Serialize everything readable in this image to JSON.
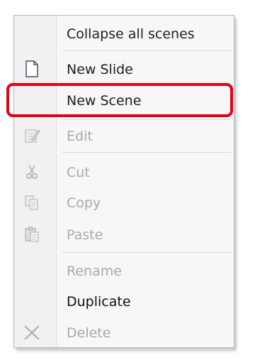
{
  "menu": {
    "items": [
      {
        "label": "Collapse all scenes",
        "state": "enabled"
      },
      {
        "label": "New Slide",
        "state": "enabled",
        "icon": "new-slide-icon"
      },
      {
        "label": "New Scene",
        "state": "enabled",
        "highlighted": true
      },
      {
        "label": "Edit",
        "state": "disabled",
        "icon": "edit-icon"
      },
      {
        "label": "Cut",
        "state": "disabled",
        "icon": "cut-icon"
      },
      {
        "label": "Copy",
        "state": "disabled",
        "icon": "copy-icon"
      },
      {
        "label": "Paste",
        "state": "disabled",
        "icon": "paste-icon"
      },
      {
        "label": "Rename",
        "state": "disabled"
      },
      {
        "label": "Duplicate",
        "state": "enabled"
      },
      {
        "label": "Delete",
        "state": "disabled",
        "icon": "delete-icon"
      }
    ]
  },
  "colors": {
    "highlight": "#e2001a",
    "menu_background": "#f7f7f7",
    "gutter_background": "#f1f1f1",
    "disabled_text": "#a9a9a9",
    "enabled_text": "#202020"
  }
}
